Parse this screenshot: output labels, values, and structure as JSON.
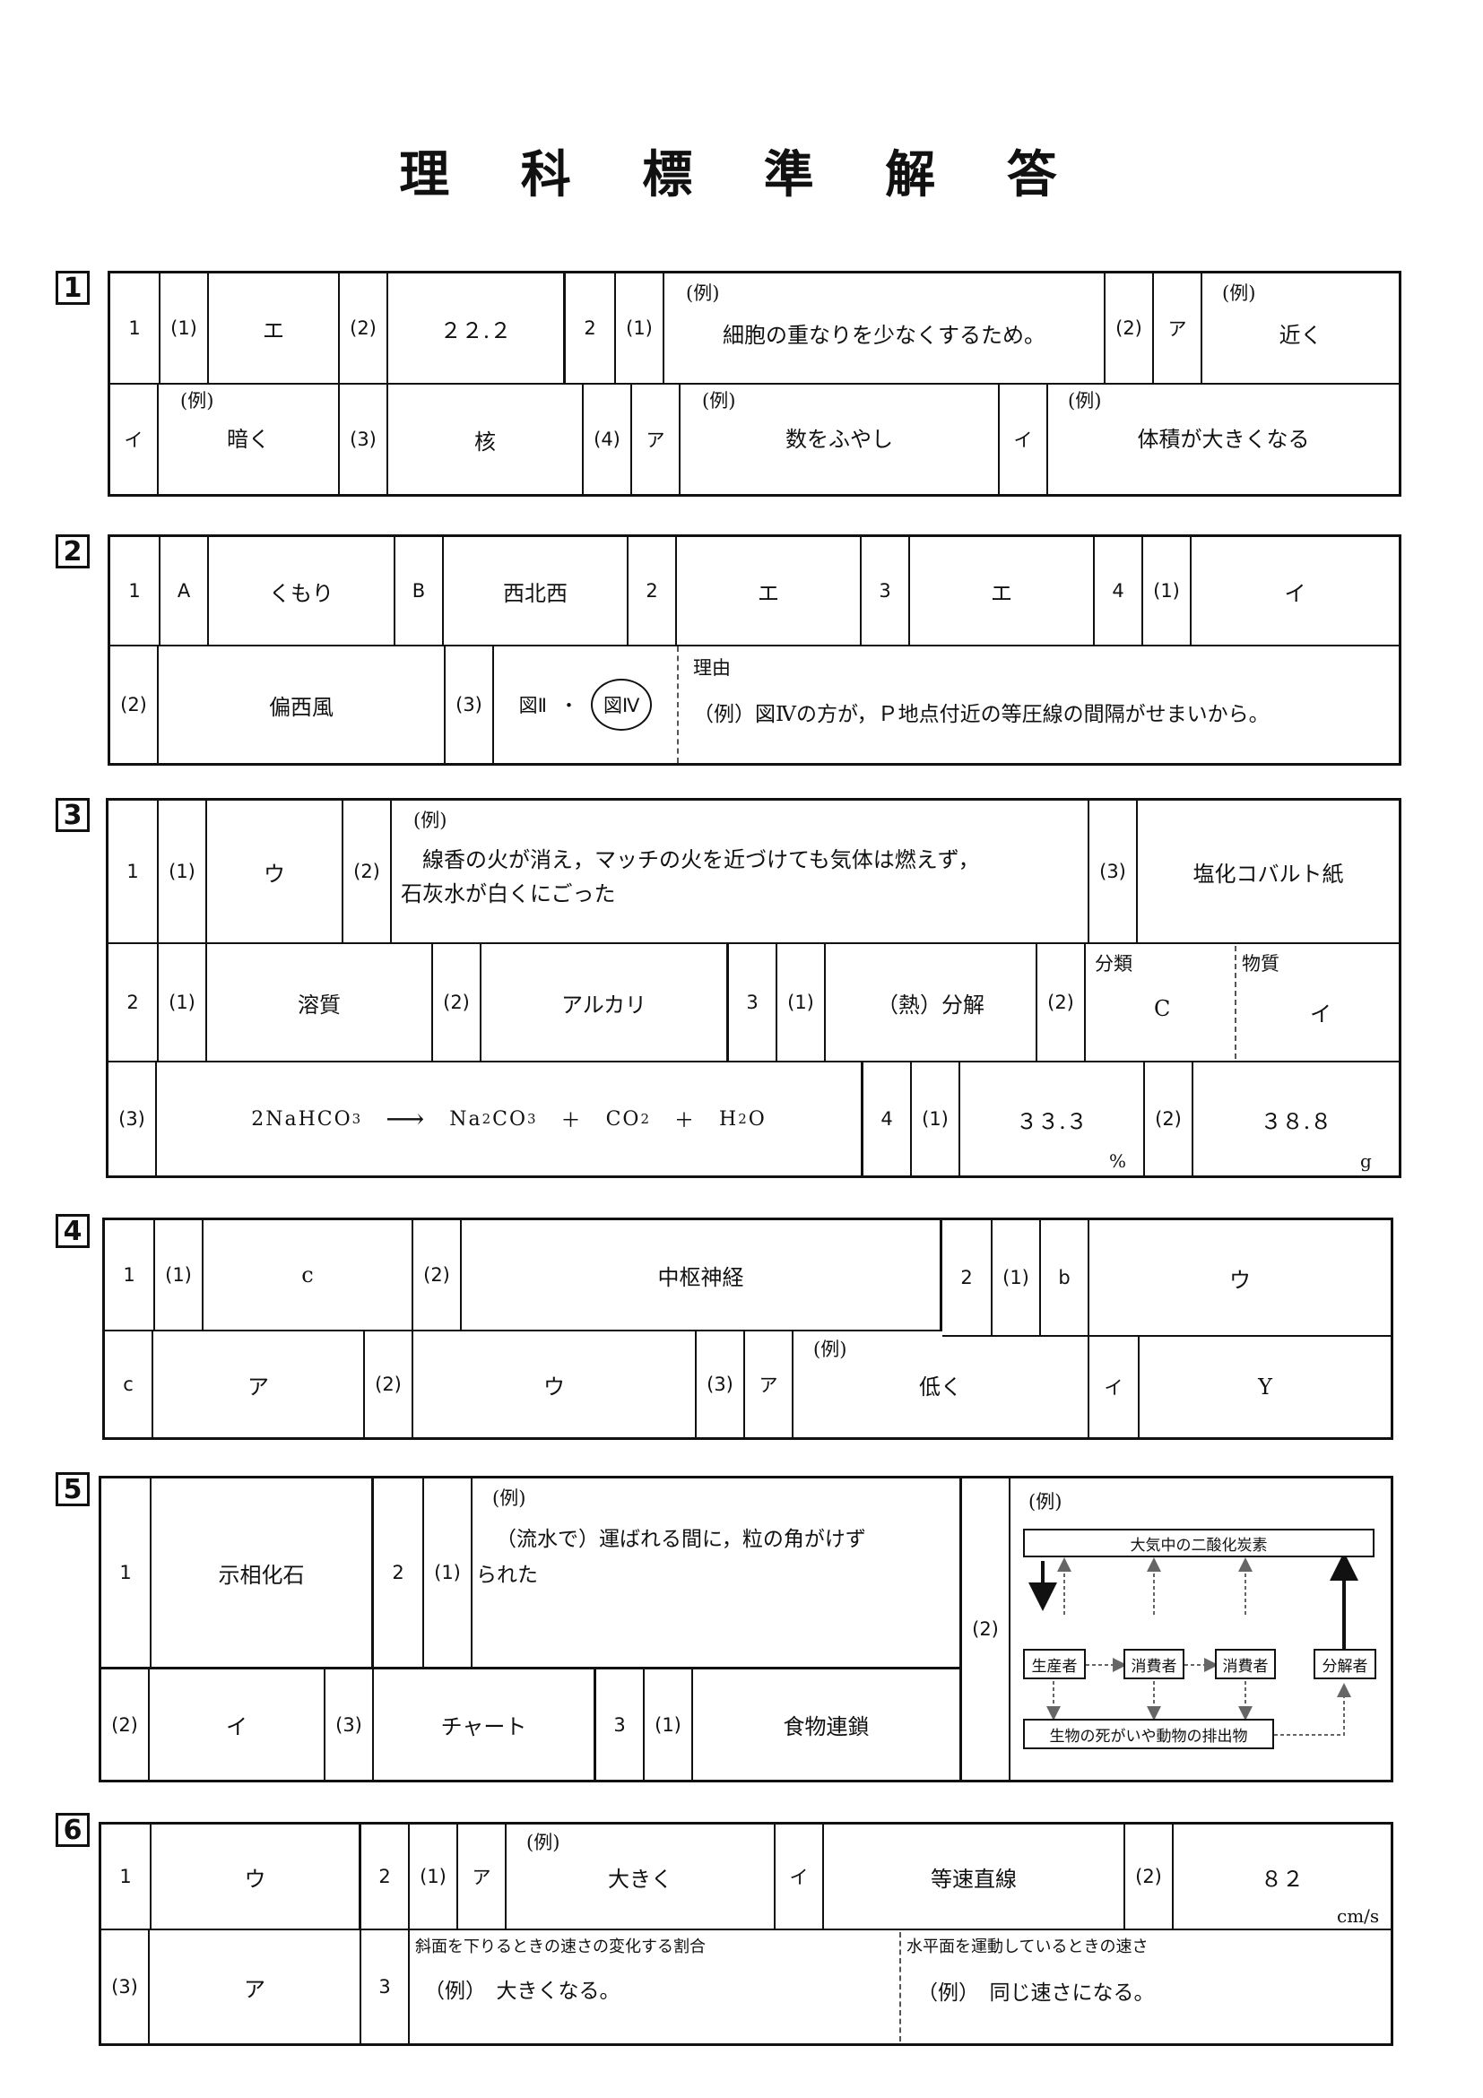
{
  "title": "理 科 標 準 解 答",
  "q1": {
    "num": "1",
    "r1": {
      "n1": "1",
      "p1": "(1)",
      "a1": "エ",
      "p2": "(2)",
      "a2": "２２.２",
      "n2": "2",
      "p3": "(1)",
      "ex3": "(例)",
      "a3": "細胞の重なりを少なくするため。",
      "p4": "(2)",
      "k4": "ア",
      "ex4": "(例)",
      "a4": "近く"
    },
    "r2": {
      "k1": "イ",
      "ex1": "(例)",
      "a1": "暗く",
      "p2": "(3)",
      "a2": "核",
      "p3": "(4)",
      "k3": "ア",
      "ex3": "(例)",
      "a3": "数をふやし",
      "k4": "イ",
      "ex4": "(例)",
      "a4": "体積が大きくなる"
    }
  },
  "q2": {
    "num": "2",
    "r1": {
      "n1": "1",
      "k1": "A",
      "a1": "くもり",
      "k2": "B",
      "a2": "西北西",
      "n2": "2",
      "a3": "エ",
      "n3": "3",
      "a4": "エ",
      "n4": "4",
      "p5": "(1)",
      "a5": "イ"
    },
    "r2": {
      "p1": "(2)",
      "a1": "偏西風",
      "p2": "(3)",
      "fig2": "図Ⅱ",
      "dot": "・",
      "fig4": "図Ⅳ",
      "reason_label": "理由",
      "reason": "（例）図Ⅳの方が，Ｐ地点付近の等圧線の間隔がせまいから。"
    }
  },
  "q3": {
    "num": "3",
    "r1": {
      "n1": "1",
      "p1": "(1)",
      "a1": "ウ",
      "p2": "(2)",
      "ex2": "(例)",
      "a2_l1": "線香の火が消え，マッチの火を近づけても気体は燃えず，",
      "a2_l2": "石灰水が白くにごった",
      "p3": "(3)",
      "a3": "塩化コバルト紙"
    },
    "r2": {
      "n1": "2",
      "p1": "(1)",
      "a1": "溶質",
      "p2": "(2)",
      "a2": "アルカリ",
      "n3": "3",
      "p3": "(1)",
      "a3": "（熱）分解",
      "p4": "(2)",
      "cls_label": "分類",
      "cls": "C",
      "sub_label": "物質",
      "sub": "イ"
    },
    "r3": {
      "p1": "(3)",
      "eq_left": "2NaHCO",
      "eq_s1": "3",
      "eq_arrow": "⟶",
      "eq_r1": "Na",
      "eq_s2": "2",
      "eq_r2": "CO",
      "eq_s3": "3",
      "eq_plus1": "＋",
      "eq_r3": "CO",
      "eq_s4": "2",
      "eq_plus2": "＋",
      "eq_r4": "H",
      "eq_s5": "2",
      "eq_r5": "O",
      "n4": "4",
      "p4": "(1)",
      "a4": "３３.３",
      "u4": "%",
      "p5": "(2)",
      "a5": "３８.８",
      "u5": "g"
    }
  },
  "q4": {
    "num": "4",
    "r1": {
      "n1": "1",
      "p1": "(1)",
      "a1": "c",
      "p2": "(2)",
      "a2": "中枢神経",
      "n2": "2",
      "p3": "(1)",
      "k3": "b",
      "a3": "ウ"
    },
    "r2": {
      "k1": "c",
      "a1": "ア",
      "p2": "(2)",
      "a2": "ウ",
      "p3": "(3)",
      "k3": "ア",
      "ex3": "(例)",
      "a3": "低く",
      "k4": "イ",
      "a4": "Y"
    }
  },
  "q5": {
    "num": "5",
    "r1": {
      "n1": "1",
      "a1": "示相化石",
      "n2": "2",
      "p2": "(1)",
      "ex2": "(例)",
      "a2_l1": "（流水で）運ばれる間に，粒の角がけず",
      "a2_l2": "られた"
    },
    "r2": {
      "p1": "(2)",
      "a1": "イ",
      "p2": "(3)",
      "a2": "チャート",
      "n3": "3",
      "p3": "(1)",
      "a3": "食物連鎖"
    },
    "diagram": {
      "p": "(2)",
      "ex": "(例)",
      "top": "大気中の二酸化炭素",
      "producer": "生産者",
      "consumer1": "消費者",
      "consumer2": "消費者",
      "decomposer": "分解者",
      "bottom": "生物の死がいや動物の排出物"
    }
  },
  "q6": {
    "num": "6",
    "r1": {
      "n1": "1",
      "a1": "ウ",
      "n2": "2",
      "p2": "(1)",
      "k2": "ア",
      "ex2": "(例)",
      "a2": "大きく",
      "k3": "イ",
      "a3": "等速直線",
      "p4": "(2)",
      "a4": "８２",
      "u4": "cm/s"
    },
    "r2": {
      "p1": "(3)",
      "a1": "ア",
      "n3": "3",
      "h1": "斜面を下りるときの速さの変化する割合",
      "a3": "（例）　大きくなる。",
      "h2": "水平面を運動しているときの速さ",
      "a4": "（例）　同じ速さになる。"
    }
  },
  "colors": {
    "ink": "#111111",
    "dash": "#555555"
  }
}
